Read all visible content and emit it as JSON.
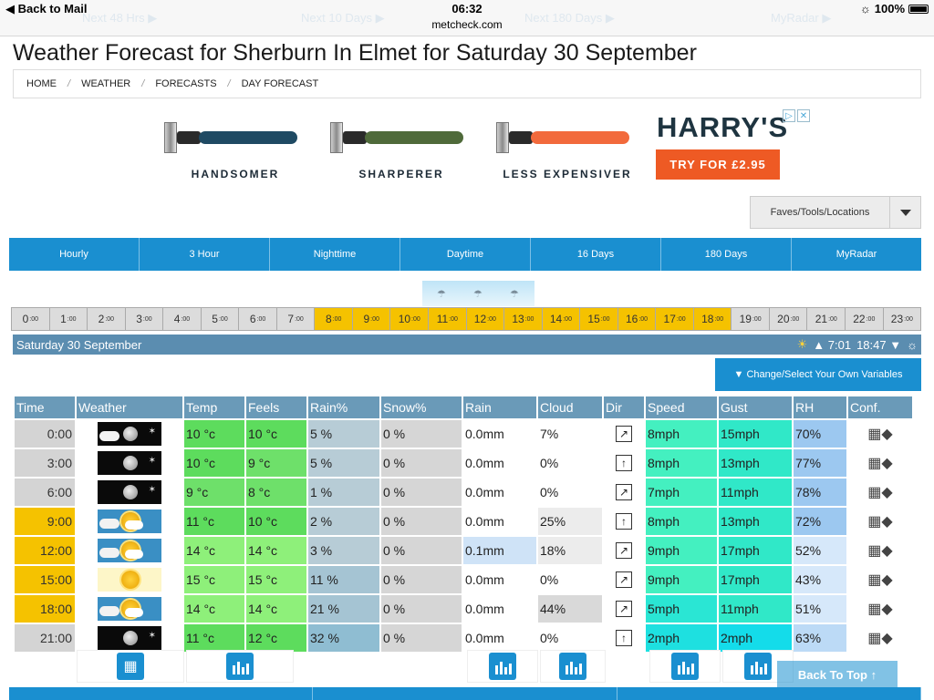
{
  "status": {
    "back_label": "Back to Mail",
    "time": "06:32",
    "url": "metcheck.com",
    "battery": "100%",
    "ghost_links": [
      "Next 48 Hrs ▶",
      "Next 10 Days ▶",
      "Next 180 Days ▶",
      "MyRadar ▶"
    ]
  },
  "page": {
    "title": "Weather Forecast for Sherburn In Elmet for Saturday 30 September",
    "breadcrumb": [
      "HOME",
      "WEATHER",
      "FORECASTS",
      "DAY FORECAST"
    ]
  },
  "ad": {
    "captions": [
      "HANDSOMER",
      "SHARPERER",
      "LESS EXPENSIVER"
    ],
    "brand": "HARRY'S",
    "cta": "TRY FOR £2.95",
    "handle_colors": [
      "#1f4a63",
      "#4f6a3a",
      "#f26a3c"
    ]
  },
  "faves": {
    "label": "Faves/Tools/Locations"
  },
  "tabs": [
    "Hourly",
    "3 Hour",
    "Nighttime",
    "Daytime",
    "16 Days",
    "180 Days",
    "MyRadar"
  ],
  "hours": [
    {
      "h": "0",
      "m": ":00",
      "day": false
    },
    {
      "h": "1",
      "m": ":00",
      "day": false
    },
    {
      "h": "2",
      "m": ":00",
      "day": false
    },
    {
      "h": "3",
      "m": ":00",
      "day": false
    },
    {
      "h": "4",
      "m": ":00",
      "day": false
    },
    {
      "h": "5",
      "m": ":00",
      "day": false
    },
    {
      "h": "6",
      "m": ":00",
      "day": false
    },
    {
      "h": "7",
      "m": ":00",
      "day": false
    },
    {
      "h": "8",
      "m": ":00",
      "day": true
    },
    {
      "h": "9",
      "m": ":00",
      "day": true
    },
    {
      "h": "10",
      "m": ":00",
      "day": true
    },
    {
      "h": "11",
      "m": ":00",
      "day": true
    },
    {
      "h": "12",
      "m": ":00",
      "day": true
    },
    {
      "h": "13",
      "m": ":00",
      "day": true
    },
    {
      "h": "14",
      "m": ":00",
      "day": true
    },
    {
      "h": "15",
      "m": ":00",
      "day": true
    },
    {
      "h": "16",
      "m": ":00",
      "day": true
    },
    {
      "h": "17",
      "m": ":00",
      "day": true
    },
    {
      "h": "18",
      "m": ":00",
      "day": true
    },
    {
      "h": "19",
      "m": ":00",
      "day": false
    },
    {
      "h": "20",
      "m": ":00",
      "day": false
    },
    {
      "h": "21",
      "m": ":00",
      "day": false
    },
    {
      "h": "22",
      "m": ":00",
      "day": false
    },
    {
      "h": "23",
      "m": ":00",
      "day": false
    }
  ],
  "day_header": {
    "label": "Saturday 30 September",
    "sunrise": "▲ 7:01",
    "sunset": "18:47 ▼"
  },
  "change_button": "▼ Change/Select Your Own Variables",
  "table": {
    "headers": [
      "Time",
      "Weather",
      "Temp",
      "Feels",
      "Rain%",
      "Snow%",
      "Rain",
      "Cloud",
      "Dir",
      "Speed",
      "Gust",
      "RH",
      "Conf."
    ],
    "rows": [
      {
        "time": "0:00",
        "day": false,
        "wx": "night-partly-cloudy-icon",
        "temp": "10 °c",
        "feels": "10 °c",
        "rainp": "5 %",
        "snowp": "0 %",
        "rain": "0.0mm",
        "cloud": "7%",
        "dir": "↗",
        "speed": "8mph",
        "gust": "15mph",
        "rh": "70%"
      },
      {
        "time": "3:00",
        "day": false,
        "wx": "night-clear-icon",
        "temp": "10 °c",
        "feels": "9 °c",
        "rainp": "5 %",
        "snowp": "0 %",
        "rain": "0.0mm",
        "cloud": "0%",
        "dir": "↑",
        "speed": "8mph",
        "gust": "13mph",
        "rh": "77%"
      },
      {
        "time": "6:00",
        "day": false,
        "wx": "night-clear-icon",
        "temp": "9 °c",
        "feels": "8 °c",
        "rainp": "1 %",
        "snowp": "0 %",
        "rain": "0.0mm",
        "cloud": "0%",
        "dir": "↗",
        "speed": "7mph",
        "gust": "11mph",
        "rh": "78%"
      },
      {
        "time": "9:00",
        "day": true,
        "wx": "sun-cloud-icon",
        "temp": "11 °c",
        "feels": "10 °c",
        "rainp": "2 %",
        "snowp": "0 %",
        "rain": "0.0mm",
        "cloud": "25%",
        "dir": "↑",
        "speed": "8mph",
        "gust": "13mph",
        "rh": "72%"
      },
      {
        "time": "12:00",
        "day": true,
        "wx": "sun-cloud-icon",
        "temp": "14 °c",
        "feels": "14 °c",
        "rainp": "3 %",
        "snowp": "0 %",
        "rain": "0.1mm",
        "cloud": "18%",
        "dir": "↗",
        "speed": "9mph",
        "gust": "17mph",
        "rh": "52%"
      },
      {
        "time": "15:00",
        "day": true,
        "wx": "sunny-icon",
        "temp": "15 °c",
        "feels": "15 °c",
        "rainp": "11 %",
        "snowp": "0 %",
        "rain": "0.0mm",
        "cloud": "0%",
        "dir": "↗",
        "speed": "9mph",
        "gust": "17mph",
        "rh": "43%"
      },
      {
        "time": "18:00",
        "day": true,
        "wx": "sun-cloud-icon",
        "temp": "14 °c",
        "feels": "14 °c",
        "rainp": "21 %",
        "snowp": "0 %",
        "rain": "0.0mm",
        "cloud": "44%",
        "dir": "↗",
        "speed": "5mph",
        "gust": "11mph",
        "rh": "51%"
      },
      {
        "time": "21:00",
        "day": false,
        "wx": "night-clear-icon",
        "temp": "11 °c",
        "feels": "12 °c",
        "rainp": "32 %",
        "snowp": "0 %",
        "rain": "0.0mm",
        "cloud": "0%",
        "dir": "↑",
        "speed": "2mph",
        "gust": "2mph",
        "rh": "63%"
      }
    ]
  },
  "back_to_top": "Back To Top ↑",
  "colors": {
    "accent": "#1a8fd0",
    "daylight": "#f5c200",
    "header": "#6a9ab8"
  }
}
